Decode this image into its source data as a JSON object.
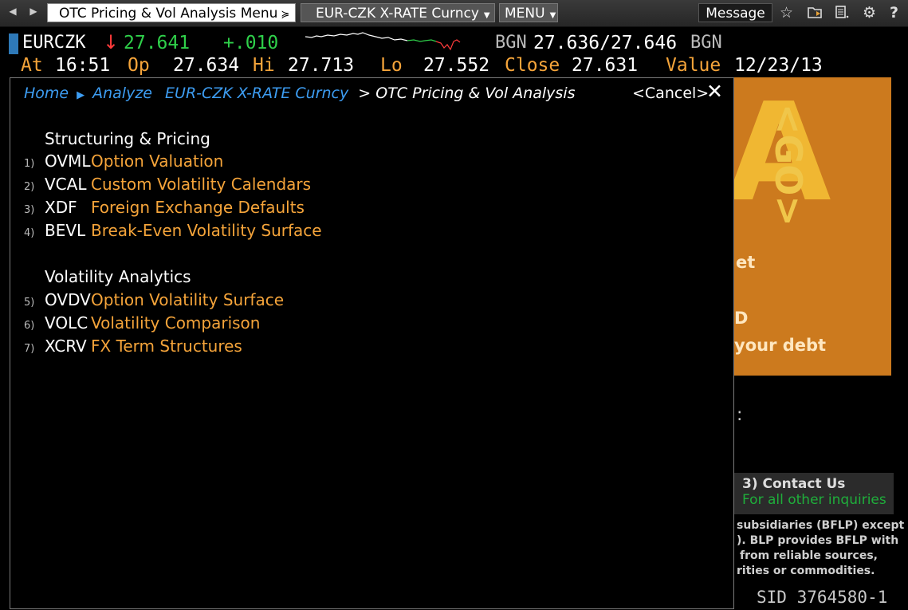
{
  "toolbar": {
    "back_arrow": "◀",
    "forward_arrow": "▶",
    "menu_title": "OTC Pricing & Vol Analysis Menu",
    "security": "EUR-CZK X-RATE Curncy",
    "menu_label": "MENU",
    "message_label": "Message",
    "icons": [
      "star-icon",
      "folder-icon",
      "document-icon",
      "gear-icon",
      "help-icon"
    ]
  },
  "ticker": {
    "symbol": "EURCZK",
    "direction_arrow": "↓",
    "last": "27.641",
    "change": "+.010",
    "bid_ask_label": "BGN",
    "bid": "27.636",
    "ask": "27.646",
    "ask_label": "BGN",
    "at_label": "At",
    "at_value": "16:51",
    "op_label": "Op",
    "op_value": "27.634",
    "hi_label": "Hi",
    "hi_value": "27.713",
    "lo_label": "Lo",
    "lo_value": "27.552",
    "close_label": "Close",
    "close_value": "27.631",
    "value_label": "Value",
    "value_date": "12/23/13",
    "colors": {
      "up": "#2fd04a",
      "down": "#ff3b3b",
      "label": "#f5a43a"
    }
  },
  "panel": {
    "breadcrumb": [
      "Home",
      "Analyze",
      "EUR-CZK X-RATE Curncy",
      "OTC Pricing & Vol Analysis"
    ],
    "breadcrumb_arrow": "▶",
    "breadcrumb_sep": ">",
    "cancel": "<Cancel>",
    "close": "✕",
    "sections": [
      {
        "title": "Structuring & Pricing",
        "items": [
          {
            "num": "1)",
            "code": "OVML",
            "label": "Option Valuation"
          },
          {
            "num": "2)",
            "code": "VCAL",
            "label": "Custom Volatility Calendars"
          },
          {
            "num": "3)",
            "code": "XDF",
            "label": "Foreign Exchange Defaults"
          },
          {
            "num": "4)",
            "code": "BEVL",
            "label": "Break-Even Volatility Surface"
          }
        ]
      },
      {
        "title": "Volatility Analytics",
        "items": [
          {
            "num": "5)",
            "code": "OVDV",
            "label": "Option Volatility Surface"
          },
          {
            "num": "6)",
            "code": "VOLC",
            "label": "Volatility Comparison"
          },
          {
            "num": "7)",
            "code": "XCRV",
            "label": "FX Term Structures"
          }
        ]
      }
    ]
  },
  "background": {
    "ad_big_letter": "A",
    "ad_go": "<GO>",
    "ad_line1": "et",
    "ad_line2": "D",
    "ad_line3": "your debt",
    "side_colon": ":",
    "contact_title": "3)  Contact Us",
    "contact_sub": "For all other inquiries",
    "legal": [
      "subsidiaries (BFLP) except",
      "). BLP provides BFLP with",
      "from reliable sources,",
      "rities or commodities."
    ],
    "sid": "SID 3764580-1"
  }
}
